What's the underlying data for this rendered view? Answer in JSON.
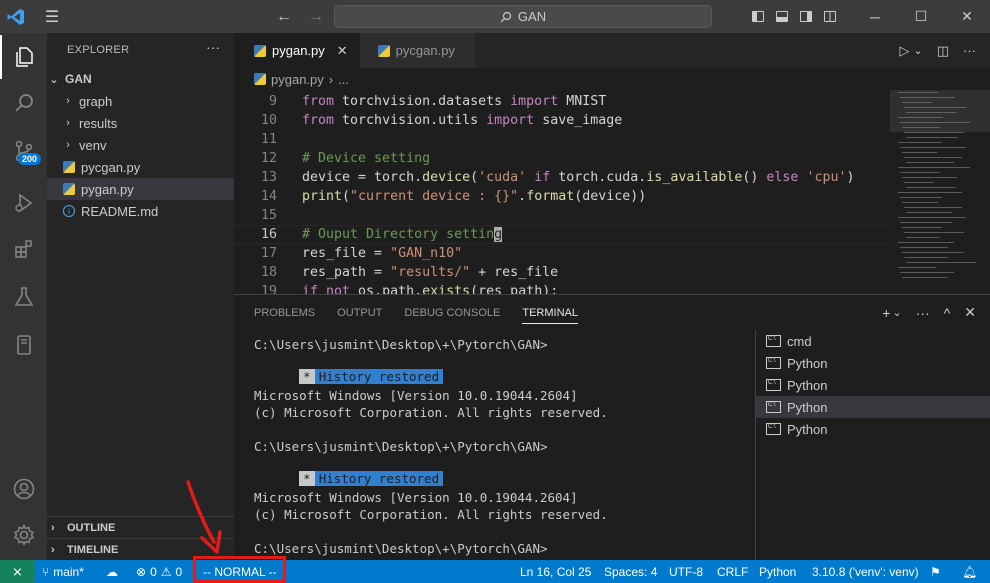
{
  "titlebar": {
    "search_text": "GAN",
    "back_icon": "←",
    "forward_icon": "→",
    "window_controls": [
      "minimize",
      "maximize",
      "close"
    ]
  },
  "activity_bar": {
    "items": [
      "explorer",
      "search",
      "source-control",
      "run-debug",
      "extensions",
      "testing",
      "remote-explorer"
    ],
    "source_control_badge": "200",
    "bottom_items": [
      "accounts",
      "manage"
    ]
  },
  "sidebar": {
    "title": "EXPLORER",
    "folder": "GAN",
    "items": [
      {
        "label": "graph",
        "type": "folder"
      },
      {
        "label": "results",
        "type": "folder"
      },
      {
        "label": "venv",
        "type": "folder"
      },
      {
        "label": "pycgan.py",
        "type": "python"
      },
      {
        "label": "pygan.py",
        "type": "python"
      },
      {
        "label": "README.md",
        "type": "info"
      }
    ],
    "sections": [
      "OUTLINE",
      "TIMELINE"
    ]
  },
  "editor": {
    "tabs": [
      {
        "label": "pygan.py",
        "active": true
      },
      {
        "label": "pycgan.py",
        "active": false
      }
    ],
    "breadcrumb": [
      "pygan.py",
      "..."
    ],
    "lines": [
      {
        "n": "9",
        "text": "from torchvision.datasets import MNIST"
      },
      {
        "n": "10",
        "text": "from torchvision.utils import save_image"
      },
      {
        "n": "11",
        "text": ""
      },
      {
        "n": "12",
        "text": "# Device setting"
      },
      {
        "n": "13",
        "text": "device = torch.device('cuda' if torch.cuda.is_available() else 'cpu')"
      },
      {
        "n": "14",
        "text": "print(\"current device : {}\".format(device))"
      },
      {
        "n": "15",
        "text": ""
      },
      {
        "n": "16",
        "text": "# Ouput Directory setting"
      },
      {
        "n": "17",
        "text": "res_file = \"GAN_n10\""
      },
      {
        "n": "18",
        "text": "res_path = \"results/\" + res_file"
      },
      {
        "n": "19",
        "text": "if not os.path.exists(res_path):"
      }
    ]
  },
  "panel": {
    "tabs": [
      "PROBLEMS",
      "OUTPUT",
      "DEBUG CONSOLE",
      "TERMINAL"
    ],
    "active_tab": "TERMINAL",
    "terminal_lines": {
      "prompt": "C:\\Users\\jusmint\\Desktop\\+\\Pytorch\\GAN>",
      "star": "*",
      "history": "History restored",
      "win_version": "Microsoft Windows [Version 10.0.19044.2604]",
      "copyright": "(c) Microsoft Corporation. All rights reserved."
    },
    "terminals": [
      "cmd",
      "Python",
      "Python",
      "Python",
      "Python"
    ],
    "selected_terminal": 3
  },
  "statusbar": {
    "branch": "main*",
    "errors": "0",
    "warnings": "0",
    "vim_mode": "-- NORMAL --",
    "position": "Ln 16, Col 25",
    "spaces": "Spaces: 4",
    "encoding": "UTF-8",
    "eol": "CRLF",
    "language": "Python",
    "interpreter": "3.10.8 ('venv': venv)"
  },
  "annotation": {
    "highlight_color": "#e31b1b"
  }
}
